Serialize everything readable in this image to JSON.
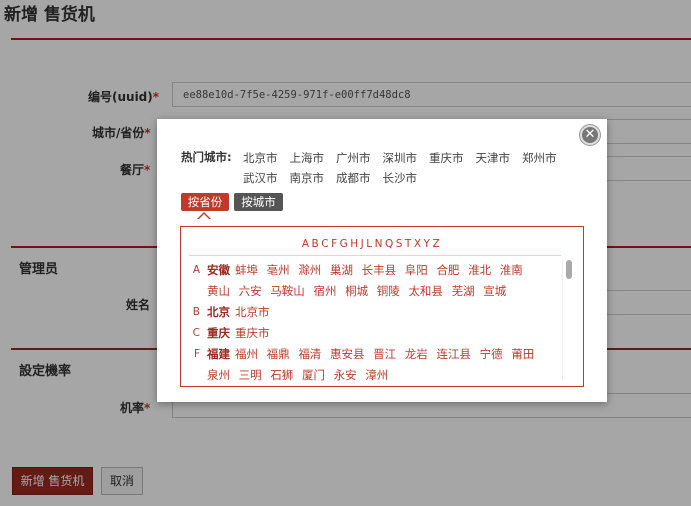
{
  "page": {
    "title": "新增 售货机",
    "fields": {
      "uuid_label": "编号(uuid)",
      "uuid_value": "ee88e10d-7f5e-4259-971f-e00ff7d48dc8",
      "city_label": "城市/省份",
      "restaurant_label": "餐厅",
      "required_mark": "*"
    },
    "admin_section": {
      "title": "管理员",
      "name_label": "姓名"
    },
    "rate_section": {
      "title": "設定機率",
      "rate_label": "机率"
    },
    "buttons": {
      "submit": "新增 售货机",
      "cancel": "取消"
    }
  },
  "modal": {
    "close_label": "✕",
    "hot_label": "热门城市:",
    "hot_cities": [
      "北京市",
      "上海市",
      "广州市",
      "深圳市",
      "重庆市",
      "天津市",
      "郑州市",
      "武汉市",
      "南京市",
      "成都市",
      "长沙市"
    ],
    "tabs": {
      "by_province": "按省份",
      "by_city": "按城市"
    },
    "alphabet": [
      "A",
      "B",
      "C",
      "F",
      "G",
      "H",
      "J",
      "L",
      "N",
      "Q",
      "S",
      "T",
      "X",
      "Y",
      "Z"
    ],
    "provinces": [
      {
        "letter": "A",
        "name": "安徽",
        "cities": [
          "蚌埠",
          "亳州",
          "滁州",
          "巢湖",
          "长丰县",
          "阜阳",
          "合肥",
          "淮北",
          "淮南",
          "黄山",
          "六安",
          "马鞍山",
          "宿州",
          "桐城",
          "铜陵",
          "太和县",
          "芜湖",
          "宣城"
        ]
      },
      {
        "letter": "B",
        "name": "北京",
        "cities": [
          "北京市"
        ]
      },
      {
        "letter": "C",
        "name": "重庆",
        "cities": [
          "重庆市"
        ]
      },
      {
        "letter": "F",
        "name": "福建",
        "cities": [
          "福州",
          "福鼎",
          "福清",
          "惠安县",
          "晋江",
          "龙岩",
          "连江县",
          "宁德",
          "莆田",
          "泉州",
          "三明",
          "石狮",
          "厦门",
          "永安",
          "漳州"
        ]
      }
    ]
  },
  "colors": {
    "accent": "#c0392b",
    "dark_accent": "#9a2a22",
    "tab_inactive": "#555555"
  }
}
